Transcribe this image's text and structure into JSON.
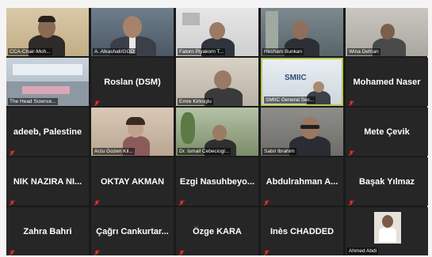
{
  "colors": {
    "grid_bg": "#1a1a1a",
    "tile_bg": "#262626",
    "active_border": "#b9c84a",
    "mic_muted": "#e0302a"
  },
  "tiles": [
    {
      "name": "CCA-Chair-Moh...",
      "type": "video"
    },
    {
      "name": "A. Alkashali/GGO",
      "type": "video"
    },
    {
      "name": "Fatorn Piyakorn T...",
      "type": "video"
    },
    {
      "name": "Hesham Bunkan",
      "type": "video"
    },
    {
      "name": "Wina Defrian",
      "type": "video"
    },
    {
      "name": "The Head Science...",
      "type": "video"
    },
    {
      "name": "Roslan (DSM)",
      "type": "name"
    },
    {
      "name": "Emre Kirkoglu",
      "type": "video"
    },
    {
      "name": "SMIIC General Sec...",
      "type": "video"
    },
    {
      "name": "Mohamed Naser",
      "type": "name"
    },
    {
      "name": "adeeb, Palestine",
      "type": "name"
    },
    {
      "name": "Arzu Gozen Kil...",
      "type": "video"
    },
    {
      "name": "Dr. Ismail Cebeciogl...",
      "type": "video"
    },
    {
      "name": "Sabri Ibrahim",
      "type": "video"
    },
    {
      "name": "Mete Çevik",
      "type": "name"
    },
    {
      "name": "NIK NAZIRA NI...",
      "type": "name"
    },
    {
      "name": "OKTAY AKMAN",
      "type": "name"
    },
    {
      "name": "Ezgi Nasuhbeyo...",
      "type": "name"
    },
    {
      "name": "Abdulrahman A...",
      "type": "name"
    },
    {
      "name": "Başak Yılmaz",
      "type": "name"
    },
    {
      "name": "Zahra Bahri",
      "type": "name"
    },
    {
      "name": "Çağrı Cankurtar...",
      "type": "name"
    },
    {
      "name": "Özge KARA",
      "type": "name"
    },
    {
      "name": "Inès CHADDED",
      "type": "name"
    },
    {
      "name": "Ahmed Abdi",
      "type": "video"
    }
  ],
  "smiic_logo": "SMIIC"
}
